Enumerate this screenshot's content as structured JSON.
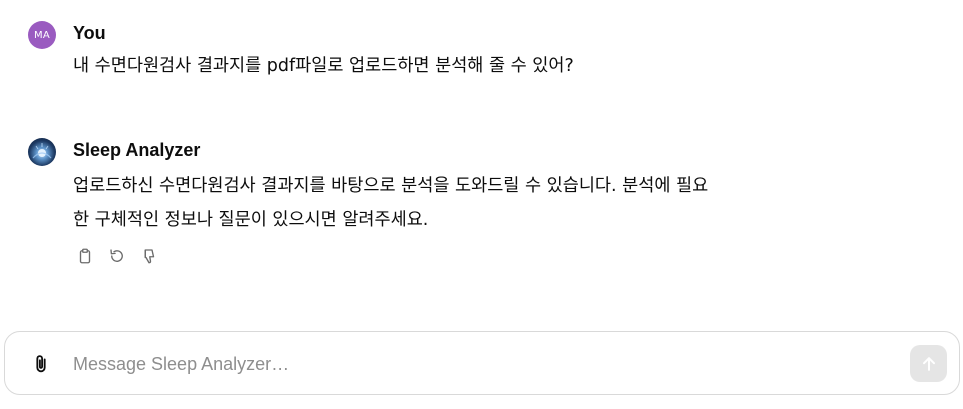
{
  "conversation": {
    "user_message": {
      "avatar_initials": "MA",
      "sender": "You",
      "text": "내 수면다원검사 결과지를 pdf파일로 업로드하면 분석해 줄 수 있어?"
    },
    "assistant_message": {
      "avatar_icon": "sleep-analyzer-avatar",
      "sender": "Sleep Analyzer",
      "lines": [
        "업로드하신 수면다원검사 결과지를 바탕으로 분석을 도와드릴 수 있습니다. 분석에 필요",
        "한 구체적인 정보나 질문이 있으시면 알려주세요."
      ],
      "actions": [
        {
          "icon": "clipboard-icon"
        },
        {
          "icon": "regenerate-icon"
        },
        {
          "icon": "thumbs-down-icon"
        }
      ]
    }
  },
  "composer": {
    "placeholder": "Message Sleep Analyzer…",
    "value": "",
    "attach_icon": "paperclip-icon",
    "send_icon": "arrow-up-icon"
  },
  "colors": {
    "user_avatar": "#9a5bc0",
    "send_button_disabled": "#e5e5e5",
    "placeholder": "#8e8e8e"
  }
}
